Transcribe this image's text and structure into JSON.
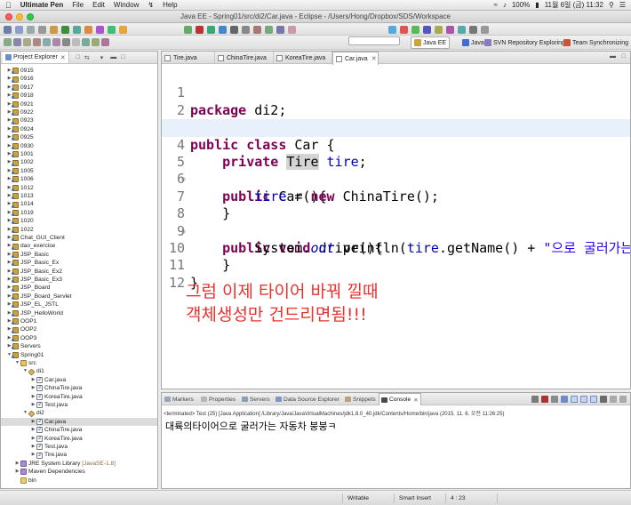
{
  "menubar": {
    "app_name": "Ultimate Pen",
    "items": [
      "File",
      "Edit",
      "Window",
      "Help"
    ],
    "battery": "100%",
    "date_time": "11월 6일 (금)  11:32"
  },
  "window": {
    "title": "Java EE - Spring01/src/di2/Car.java - Eclipse - /Users/Hong/Dropbox/SDS/Workspace"
  },
  "perspectives": [
    {
      "label": "Java EE",
      "active": true
    },
    {
      "label": "Java",
      "active": false
    },
    {
      "label": "SVN Repository Exploring",
      "active": false
    },
    {
      "label": "Team Synchronizing",
      "active": false
    }
  ],
  "explorer": {
    "title": "Project Explorer",
    "items": [
      {
        "label": "0915",
        "depth": 0,
        "twisty": "closed",
        "icon": "project"
      },
      {
        "label": "0916",
        "depth": 0,
        "twisty": "closed",
        "icon": "project"
      },
      {
        "label": "0917",
        "depth": 0,
        "twisty": "closed",
        "icon": "project"
      },
      {
        "label": "0918",
        "depth": 0,
        "twisty": "closed",
        "icon": "project"
      },
      {
        "label": "0921",
        "depth": 0,
        "twisty": "closed",
        "icon": "project"
      },
      {
        "label": "0922",
        "depth": 0,
        "twisty": "closed",
        "icon": "project"
      },
      {
        "label": "0923",
        "depth": 0,
        "twisty": "closed",
        "icon": "project"
      },
      {
        "label": "0924",
        "depth": 0,
        "twisty": "closed",
        "icon": "project"
      },
      {
        "label": "0925",
        "depth": 0,
        "twisty": "closed",
        "icon": "project"
      },
      {
        "label": "0930",
        "depth": 0,
        "twisty": "closed",
        "icon": "project"
      },
      {
        "label": "1001",
        "depth": 0,
        "twisty": "closed",
        "icon": "project"
      },
      {
        "label": "1002",
        "depth": 0,
        "twisty": "closed",
        "icon": "project"
      },
      {
        "label": "1005",
        "depth": 0,
        "twisty": "closed",
        "icon": "project"
      },
      {
        "label": "1006",
        "depth": 0,
        "twisty": "closed",
        "icon": "project"
      },
      {
        "label": "1012",
        "depth": 0,
        "twisty": "closed",
        "icon": "project"
      },
      {
        "label": "1013",
        "depth": 0,
        "twisty": "closed",
        "icon": "project"
      },
      {
        "label": "1014",
        "depth": 0,
        "twisty": "closed",
        "icon": "project"
      },
      {
        "label": "1019",
        "depth": 0,
        "twisty": "closed",
        "icon": "project"
      },
      {
        "label": "1020",
        "depth": 0,
        "twisty": "closed",
        "icon": "project"
      },
      {
        "label": "1022",
        "depth": 0,
        "twisty": "closed",
        "icon": "project"
      },
      {
        "label": "Chat_GUI_Client",
        "depth": 0,
        "twisty": "closed",
        "icon": "project"
      },
      {
        "label": "dao_exercise",
        "depth": 0,
        "twisty": "closed",
        "icon": "project"
      },
      {
        "label": "JSP_Basic",
        "depth": 0,
        "twisty": "closed",
        "icon": "project"
      },
      {
        "label": "JSP_Basic_Ex",
        "depth": 0,
        "twisty": "closed",
        "icon": "project"
      },
      {
        "label": "JSP_Basic_Ex2",
        "depth": 0,
        "twisty": "closed",
        "icon": "project"
      },
      {
        "label": "JSP_Basic_Ex3",
        "depth": 0,
        "twisty": "closed",
        "icon": "project"
      },
      {
        "label": "JSP_Board",
        "depth": 0,
        "twisty": "closed",
        "icon": "project"
      },
      {
        "label": "JSP_Board_Servlet",
        "depth": 0,
        "twisty": "closed",
        "icon": "project"
      },
      {
        "label": "JSP_EL_JSTL",
        "depth": 0,
        "twisty": "closed",
        "icon": "project"
      },
      {
        "label": "JSP_HelloWorld",
        "depth": 0,
        "twisty": "closed",
        "icon": "project"
      },
      {
        "label": "OOP1",
        "depth": 0,
        "twisty": "closed",
        "icon": "project"
      },
      {
        "label": "OOP2",
        "depth": 0,
        "twisty": "closed",
        "icon": "project"
      },
      {
        "label": "OOP3",
        "depth": 0,
        "twisty": "closed",
        "icon": "project"
      },
      {
        "label": "Servers",
        "depth": 0,
        "twisty": "closed",
        "icon": "project"
      },
      {
        "label": "Spring01",
        "depth": 0,
        "twisty": "open",
        "icon": "project"
      },
      {
        "label": "src",
        "depth": 1,
        "twisty": "open",
        "icon": "srcfolder"
      },
      {
        "label": "di1",
        "depth": 2,
        "twisty": "open",
        "icon": "package"
      },
      {
        "label": "Car.java",
        "depth": 3,
        "twisty": "closed",
        "icon": "java"
      },
      {
        "label": "ChinaTire.java",
        "depth": 3,
        "twisty": "closed",
        "icon": "java"
      },
      {
        "label": "KoreaTire.java",
        "depth": 3,
        "twisty": "closed",
        "icon": "java"
      },
      {
        "label": "Test.java",
        "depth": 3,
        "twisty": "closed",
        "icon": "java"
      },
      {
        "label": "di2",
        "depth": 2,
        "twisty": "open",
        "icon": "package"
      },
      {
        "label": "Car.java",
        "depth": 3,
        "twisty": "closed",
        "icon": "java",
        "selected": true
      },
      {
        "label": "ChinaTire.java",
        "depth": 3,
        "twisty": "closed",
        "icon": "java"
      },
      {
        "label": "KoreaTire.java",
        "depth": 3,
        "twisty": "closed",
        "icon": "java"
      },
      {
        "label": "Test.java",
        "depth": 3,
        "twisty": "closed",
        "icon": "java"
      },
      {
        "label": "Tire.java",
        "depth": 3,
        "twisty": "closed",
        "icon": "java"
      },
      {
        "label": "JRE System Library",
        "extra": "[JavaSE-1.8]",
        "depth": 1,
        "twisty": "closed",
        "icon": "lib"
      },
      {
        "label": "Maven Dependencies",
        "depth": 1,
        "twisty": "closed",
        "icon": "lib"
      },
      {
        "label": "bin",
        "depth": 1,
        "twisty": "none",
        "icon": "folder"
      }
    ]
  },
  "editor": {
    "tabs": [
      {
        "label": "Tire.java",
        "active": false
      },
      {
        "label": "ChinaTire.java",
        "active": false
      },
      {
        "label": "KoreaTire.java",
        "active": false
      },
      {
        "label": "Car.java",
        "active": true
      }
    ],
    "lines": [
      {
        "n": "1"
      },
      {
        "n": "2"
      },
      {
        "n": "3"
      },
      {
        "n": "4"
      },
      {
        "n": "5"
      },
      {
        "n": "6"
      },
      {
        "n": "7"
      },
      {
        "n": "8"
      },
      {
        "n": "9"
      },
      {
        "n": "10"
      },
      {
        "n": "11"
      },
      {
        "n": "12"
      }
    ],
    "code": {
      "l1_kw": "package",
      "l1_rest": " di2;",
      "l3_kw1": "public",
      "l3_kw2": "class",
      "l3_rest": " Car {",
      "l4_kw": "private",
      "l4_type": "Tire",
      "l4_field": "tire",
      "l4_end": ";",
      "l5_kw": "public",
      "l5_rest": " Car(){",
      "l6_field": "tire",
      "l6_mid": " = ",
      "l6_kw": "new",
      "l6_rest": " ChinaTire();",
      "l7": "}",
      "l8_kw1": "public",
      "l8_kw2": "void",
      "l8_rest": " drive(){",
      "l9_a": "System.",
      "l9_out": "out",
      "l9_b": ".println(",
      "l9_field": "tire",
      "l9_c": ".getName() + ",
      "l9_str": "\"으로 굴러가는 자",
      "l10": "}",
      "l11": "}"
    },
    "annotation_line1": "그럼 이제 타이어 바꿔 낄때",
    "annotation_line2": "객체생성만 건드리면됨!!!"
  },
  "console": {
    "tabs": [
      {
        "label": "Markers",
        "active": false
      },
      {
        "label": "Properties",
        "active": false
      },
      {
        "label": "Servers",
        "active": false
      },
      {
        "label": "Data Source Explorer",
        "active": false
      },
      {
        "label": "Snippets",
        "active": false
      },
      {
        "label": "Console",
        "active": true
      }
    ],
    "terminated": "<terminated> Test (25) [Java Application] /Library/Java/JavaVirtualMachines/jdk1.8.0_40.jdk/Contents/Home/bin/java (2015. 11. 6. 오전 11:26:25)",
    "output": "대륙의타이어으로 굴러가는 자동차 붕붕ㅋ"
  },
  "statusbar": {
    "writable": "Writable",
    "insert_mode": "Smart Insert",
    "position": "4 : 23"
  }
}
